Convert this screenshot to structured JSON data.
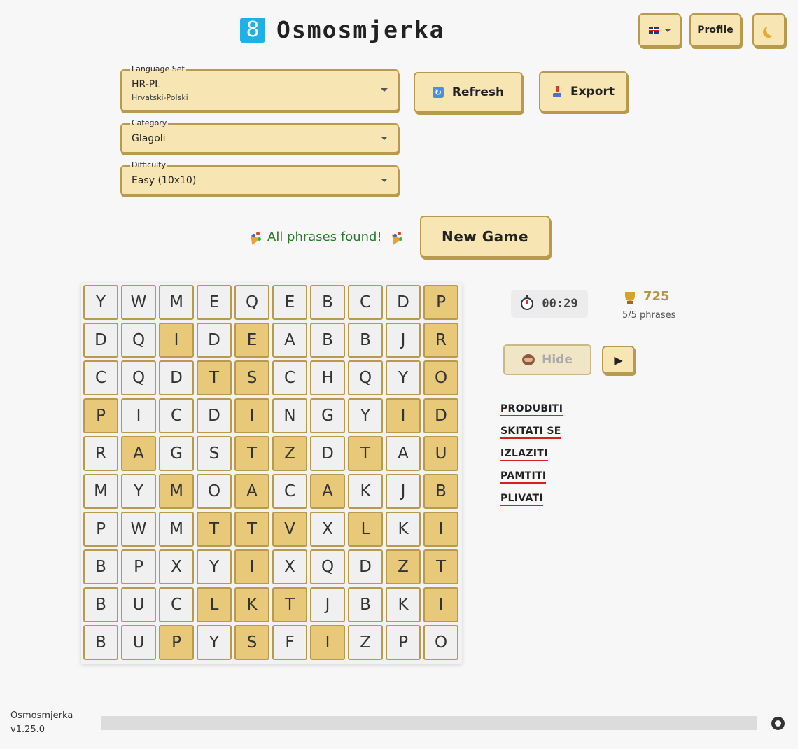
{
  "header": {
    "logo_glyph": "8",
    "title": "Osmosmjerka",
    "lang_icon": "uk-flag-icon",
    "profile_label": "Profile",
    "theme_icon": "moon-icon"
  },
  "controls": {
    "language_set": {
      "label": "Language Set",
      "value": "HR-PL",
      "sub": "Hrvatski-Polski"
    },
    "category": {
      "label": "Category",
      "value": "Glagoli"
    },
    "difficulty": {
      "label": "Difficulty",
      "value": "Easy (10x10)"
    },
    "refresh_label": "Refresh",
    "export_label": "Export"
  },
  "status": {
    "message": "All phrases found!",
    "new_game_label": "New Game"
  },
  "grid": {
    "rows": [
      "YWMEQEBCDP",
      "DQIDEABBJR",
      "CQDTSCHQYO",
      "PICDINGYID",
      "RAGSTZDTAU",
      "MYMOACAKJB",
      "PWMTTVXLKI",
      "BPXYIXQDZT",
      "BUCLKTJBKI",
      "BUPYSFIZPO"
    ],
    "highlighted": [
      [
        0,
        9
      ],
      [
        1,
        9
      ],
      [
        2,
        9
      ],
      [
        3,
        9
      ],
      [
        4,
        9
      ],
      [
        5,
        9
      ],
      [
        6,
        9
      ],
      [
        7,
        9
      ],
      [
        8,
        9
      ],
      [
        1,
        2
      ],
      [
        4,
        1
      ],
      [
        5,
        2
      ],
      [
        1,
        4
      ],
      [
        2,
        4
      ],
      [
        3,
        4
      ],
      [
        4,
        4
      ],
      [
        5,
        4
      ],
      [
        6,
        4
      ],
      [
        7,
        4
      ],
      [
        8,
        4
      ],
      [
        9,
        4
      ],
      [
        2,
        3
      ],
      [
        6,
        3
      ],
      [
        8,
        3
      ],
      [
        9,
        2
      ],
      [
        3,
        0
      ],
      [
        7,
        8
      ],
      [
        4,
        7
      ],
      [
        3,
        8
      ],
      [
        4,
        5
      ],
      [
        5,
        6
      ],
      [
        6,
        5
      ],
      [
        6,
        7
      ],
      [
        8,
        5
      ],
      [
        9,
        6
      ]
    ]
  },
  "stats": {
    "time": "00:29",
    "score": "725",
    "phrases": "5/5 phrases"
  },
  "actions": {
    "hide_label": "Hide",
    "play_glyph": "▶"
  },
  "words": [
    "PRODUBITI",
    "SKITATI SE",
    "IZLAZITI",
    "PAMTITI",
    "PLIVATI"
  ],
  "footer": {
    "name": "Osmosmjerka",
    "version": "v1.25.0",
    "repo_icon": "github-icon"
  }
}
